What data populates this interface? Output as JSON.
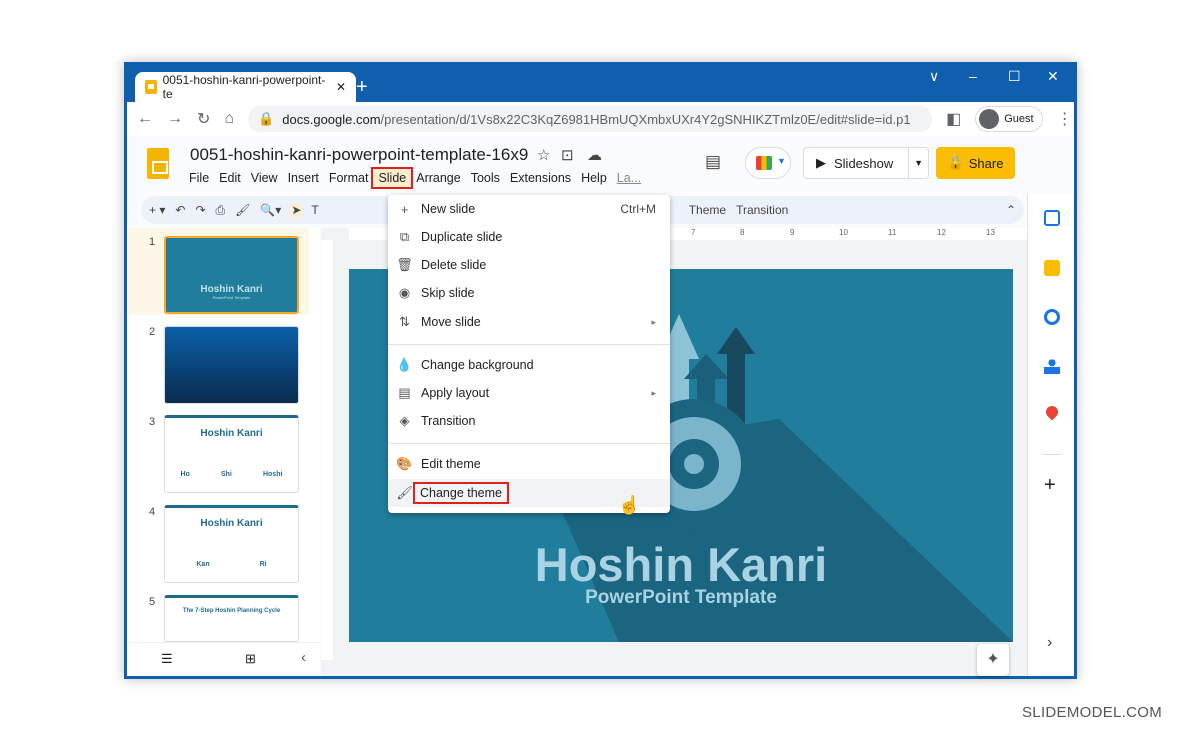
{
  "browser": {
    "tab_title": "0051-hoshin-kanri-powerpoint-te",
    "new_tab": "+",
    "url_host": "docs.google.com",
    "url_path": "/presentation/d/1Vs8x22C3KqZ6981HBmUQXmbxUXr4Y2gSNHIKZTmlz0E/edit#slide=id.p1",
    "profile": "Guest",
    "controls": [
      "∨",
      "–",
      "☐",
      "✕"
    ]
  },
  "doc": {
    "title": "0051-hoshin-kanri-powerpoint-template-16x9",
    "menus": [
      "File",
      "Edit",
      "View",
      "Insert",
      "Format",
      "Slide",
      "Arrange",
      "Tools",
      "Extensions",
      "Help",
      "La..."
    ],
    "slideshow": "Slideshow",
    "share": "Share"
  },
  "toolbar": {
    "theme": "Theme",
    "transition": "Transition"
  },
  "ruler": [
    "7",
    "8",
    "9",
    "10",
    "11",
    "12",
    "13"
  ],
  "slides": [
    {
      "num": "1",
      "title": "Hoshin Kanri",
      "sub": "PowerPoint Template"
    },
    {
      "num": "2"
    },
    {
      "num": "3",
      "title": "Hoshin Kanri",
      "labels": [
        "Ho",
        "Shi",
        "Hoshi"
      ]
    },
    {
      "num": "4",
      "title": "Hoshin Kanri",
      "labels": [
        "Kan",
        "Ri"
      ]
    },
    {
      "num": "5",
      "title": "The 7-Step Hoshin Planning Cycle"
    }
  ],
  "main_slide": {
    "title": "Hoshin Kanri",
    "subtitle": "PowerPoint Template"
  },
  "slide_menu": {
    "items": [
      {
        "label": "New slide",
        "icon": "+",
        "shortcut": "Ctrl+M"
      },
      {
        "label": "Duplicate slide",
        "icon": "⧉"
      },
      {
        "label": "Delete slide",
        "icon": "🗑"
      },
      {
        "label": "Skip slide",
        "icon": "◉"
      },
      {
        "label": "Move slide",
        "icon": "⇅",
        "submenu": "▸"
      },
      {
        "label": "Change background",
        "icon": "💧"
      },
      {
        "label": "Apply layout",
        "icon": "▤",
        "submenu": "▸"
      },
      {
        "label": "Transition",
        "icon": "◈"
      },
      {
        "label": "Edit theme",
        "icon": "🎨"
      },
      {
        "label": "Change theme",
        "icon": "🖌"
      }
    ]
  },
  "watermark": "SLIDEMODEL.COM",
  "colors": {
    "accent": "#fbbc04",
    "slide_bg": "#217d9c",
    "highlight": "#e02020"
  }
}
